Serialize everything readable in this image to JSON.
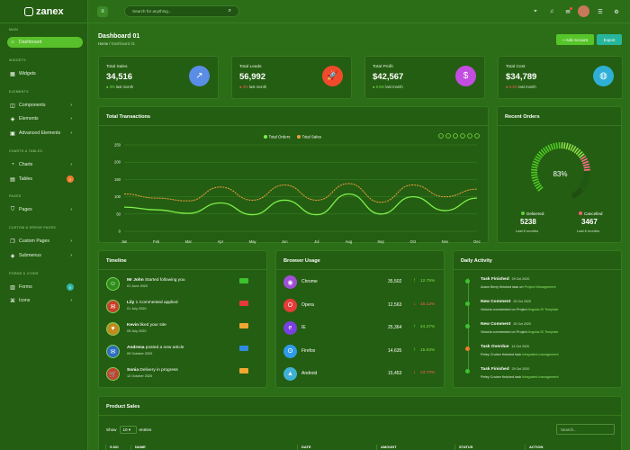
{
  "brand": {
    "name": "zanex"
  },
  "sidebar": {
    "sections": {
      "main": "MAIN",
      "widgets": "WIDGETS",
      "elements": "ELEMENTS",
      "charts": "CHARTS & TABLES",
      "pages": "PAGES",
      "custom": "CUSTOM & ERROR PAGES",
      "forms": "FORMS & ICONS"
    },
    "items": [
      {
        "label": "Dashboard",
        "icon": "home-icon"
      },
      {
        "label": "Widgets",
        "icon": "grid-icon"
      },
      {
        "label": "Components",
        "icon": "database-icon"
      },
      {
        "label": "Elements",
        "icon": "layers-icon"
      },
      {
        "label": "Advanced Elements",
        "icon": "package-icon"
      },
      {
        "label": "Charts",
        "icon": "pie-chart-icon"
      },
      {
        "label": "Tables",
        "icon": "clipboard-icon",
        "badge": "2"
      },
      {
        "label": "Pages",
        "icon": "shield-icon"
      },
      {
        "label": "Custom Pages",
        "icon": "copy-icon"
      },
      {
        "label": "Submenus",
        "icon": "layers-icon"
      },
      {
        "label": "Forms",
        "icon": "file-text-icon",
        "badge": "5"
      },
      {
        "label": "Icons",
        "icon": "command-icon"
      }
    ]
  },
  "topbar": {
    "search_placeholder": "Search for anything..."
  },
  "page": {
    "title": "Dashboard 01",
    "breadcrumb_home": "Home",
    "breadcrumb_current": "Dashboard 01",
    "add_account": "+ Add Account",
    "export": "Export"
  },
  "stats": [
    {
      "title": "Total Sales",
      "value": "34,516",
      "change": "3%",
      "suffix": "last month",
      "trend": "up",
      "color": "#5a8de6"
    },
    {
      "title": "Total Leads",
      "value": "56,992",
      "change": "3%",
      "suffix": "last month",
      "trend": "down",
      "color": "#f04a2b"
    },
    {
      "title": "Total Profit",
      "value": "$42,567",
      "change": "0.5%",
      "suffix": "last month",
      "trend": "up",
      "color": "#c24de0"
    },
    {
      "title": "Total Cost",
      "value": "$34,789",
      "change": "0.2%",
      "suffix": "last month",
      "trend": "down",
      "color": "#2eb0d6"
    }
  ],
  "transactions": {
    "title": "Total Transactions"
  },
  "chart_data": {
    "type": "line",
    "title": "Total Transactions",
    "categories": [
      "Jan",
      "Feb",
      "Mar",
      "Apr",
      "May",
      "Jun",
      "Jul",
      "Aug",
      "Sep",
      "Oct",
      "Nov",
      "Dec"
    ],
    "ylim": [
      0,
      250
    ],
    "yticks": [
      "250",
      "200",
      "150",
      "100",
      "50",
      "0"
    ],
    "series": [
      {
        "name": "Total Orders",
        "color": "#7cf04a",
        "values": [
          70,
          62,
          52,
          82,
          48,
          90,
          48,
          108,
          50,
          100,
          60,
          96
        ]
      },
      {
        "name": "Total Sales",
        "color": "#f0a040",
        "values": [
          108,
          96,
          88,
          128,
          90,
          134,
          90,
          138,
          84,
          134,
          100,
          122
        ]
      }
    ]
  },
  "recent_orders": {
    "title": "Recent Orders",
    "percent": "83%",
    "delivered_label": "Delivered",
    "delivered_value": "5238",
    "delivered_sub": "Last 6 months",
    "cancelled_label": "Cancelled",
    "cancelled_value": "3467",
    "cancelled_sub": "Last 6 months",
    "fraction": 0.83
  },
  "timeline": {
    "title": "Timeline",
    "items": [
      {
        "name": "Mr John",
        "action": " Started following you",
        "date": "01 June 2020",
        "icon": "user-plus-icon",
        "tag_color": "#3cc22d"
      },
      {
        "name": "Lily",
        "action": " 1 Commented applied",
        "date": "01 July 2020",
        "icon": "message-icon",
        "tag_color": "#e33a3a"
      },
      {
        "name": "Kevin",
        "action": " liked your site",
        "date": "05 July 2020",
        "icon": "heart-icon",
        "tag_color": "#f0a732"
      },
      {
        "name": "Andrena",
        "action": " posted a new article",
        "date": "09 October 2020",
        "icon": "mail-icon",
        "tag_color": "#2f8be0"
      },
      {
        "name": "Sonia",
        "action": " Delivery in progress",
        "date": "12 October 2020",
        "icon": "cart-icon",
        "tag_color": "#f0a732"
      }
    ]
  },
  "browser_usage": {
    "title": "Browser Usage",
    "items": [
      {
        "name": "Chrome",
        "value": "35,502",
        "pct": "12.75%",
        "trend": "up",
        "color": "#a04fd6",
        "icon": "chrome-icon"
      },
      {
        "name": "Opera",
        "value": "12,563",
        "pct": "15.12%",
        "trend": "down",
        "color": "#e63b3b",
        "icon": "opera-icon"
      },
      {
        "name": "IE",
        "value": "25,364",
        "pct": "24.37%",
        "trend": "up",
        "color": "#7a3fe0",
        "icon": "ie-icon"
      },
      {
        "name": "Firefox",
        "value": "14,635",
        "pct": "15.63%",
        "trend": "up",
        "color": "#2f9be8",
        "icon": "firefox-icon"
      },
      {
        "name": "Android",
        "value": "15,453",
        "pct": "23.70%",
        "trend": "down",
        "color": "#3fb0d6",
        "icon": "android-icon"
      }
    ]
  },
  "activity": {
    "title": "Daily Activity",
    "items": [
      {
        "title": "Task Finished",
        "date": "29 Oct 2020",
        "text": "Adam Berry finished task on ",
        "link": "Project Management",
        "color": "#3cc22d"
      },
      {
        "title": "New Comment",
        "date": "25 Oct 2020",
        "text": "Victoria commented on Project ",
        "link": "AngularJS Template",
        "color": "#3cc22d"
      },
      {
        "title": "New Comment",
        "date": "25 Oct 2020",
        "text": "Victoria commented on Project ",
        "link": "AngularJS Template",
        "color": "#3cc22d"
      },
      {
        "title": "Task Overdue",
        "date": "14 Oct 2020",
        "text": "Petey Cruiser finished task ",
        "link": "Integrated management",
        "color": "#f07a2c"
      },
      {
        "title": "Task Finished",
        "date": "29 Oct 2020",
        "text": "Petey Cruiser finished task ",
        "link": "Integrated management",
        "color": "#3cc22d"
      }
    ]
  },
  "product_sales": {
    "title": "Product Sales",
    "show": "Show",
    "entries_value": "10",
    "entries": "entries",
    "search_placeholder": "Search...",
    "columns": [
      "S.NO",
      "NAME",
      "DATE",
      "AMOUNT",
      "STATUS",
      "ACTION"
    ]
  }
}
